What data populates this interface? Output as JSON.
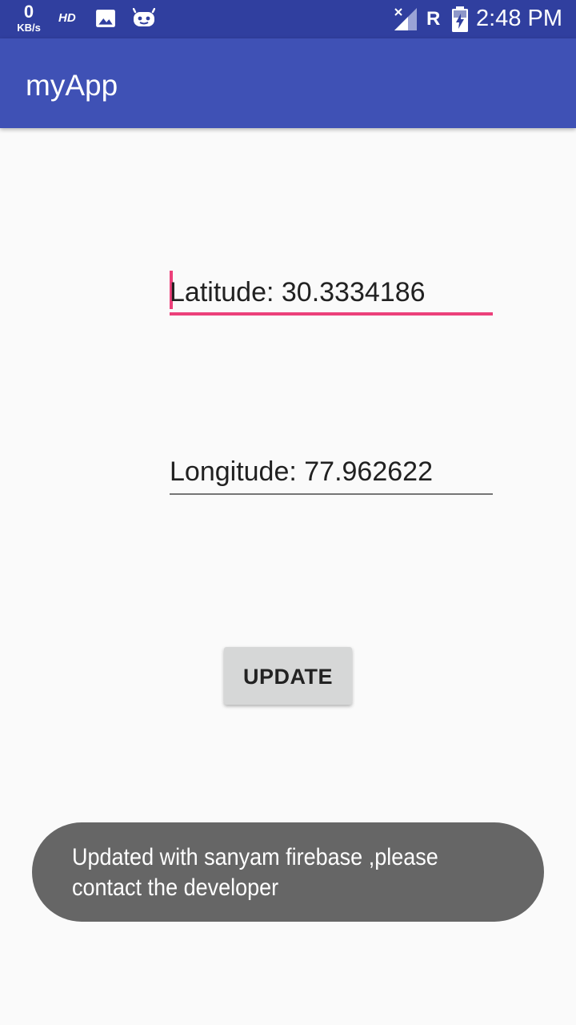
{
  "status_bar": {
    "net_speed_value": "0",
    "net_speed_unit": "KB/s",
    "hd_label": "HD",
    "roaming_label": "R",
    "time": "2:48 PM",
    "icons": [
      "image-icon",
      "android-icon",
      "signal-icon",
      "battery-icon"
    ]
  },
  "app_bar": {
    "title": "myApp",
    "color": "#3f51b5"
  },
  "form": {
    "latitude_value": "Latitude: 30.3334186",
    "longitude_value": "Longitude: 77.962622",
    "focus_color": "#ec407a"
  },
  "update_button": {
    "label": "UPDATE"
  },
  "toast": {
    "message": "Updated with sanyam firebase ,please contact the developer"
  }
}
